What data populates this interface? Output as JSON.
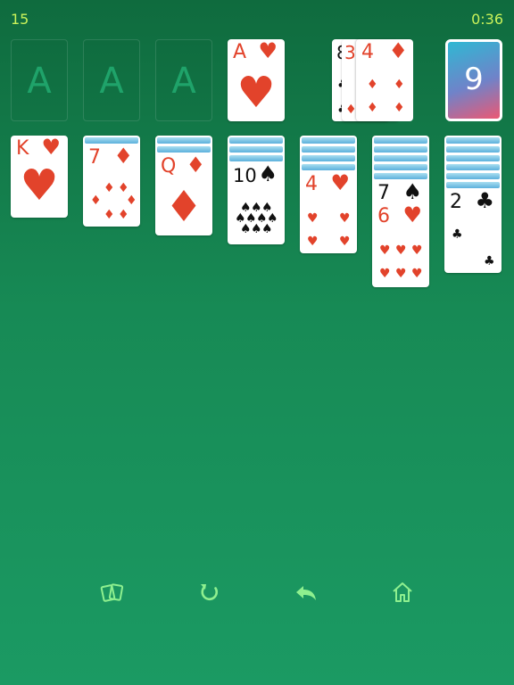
{
  "header": {
    "score": "15",
    "timer": "0:36"
  },
  "foundations": [
    {
      "label": "A"
    },
    {
      "label": "A"
    },
    {
      "label": "A"
    },
    {
      "rank": "A",
      "suit": "♥"
    }
  ],
  "waste": {
    "peek_ranks": [
      "8",
      "3"
    ],
    "top": {
      "rank": "4",
      "suit": "♦"
    }
  },
  "stock": {
    "count": "9"
  },
  "tableau": [
    {
      "top": {
        "rank": "K",
        "suit": "♥"
      }
    },
    {
      "top": {
        "rank": "7",
        "suit": "♦"
      }
    },
    {
      "top": {
        "rank": "Q",
        "suit": "♦"
      }
    },
    {
      "top": {
        "rank": "10",
        "suit": "♠"
      }
    },
    {
      "top": {
        "rank": "4",
        "suit": "♥"
      }
    },
    {
      "second": {
        "rank": "7",
        "suit": "♠"
      },
      "top": {
        "rank": "6",
        "suit": "♥"
      }
    },
    {
      "top": {
        "rank": "2",
        "suit": "♣"
      }
    }
  ],
  "toolbar": [
    {
      "icon": "cards-icon"
    },
    {
      "icon": "restart-icon"
    },
    {
      "icon": "undo-icon"
    },
    {
      "icon": "home-icon"
    }
  ],
  "colors": {
    "accent": "#c9f25a",
    "red_suit": "#e2432b",
    "icon": "#8ef08f"
  }
}
